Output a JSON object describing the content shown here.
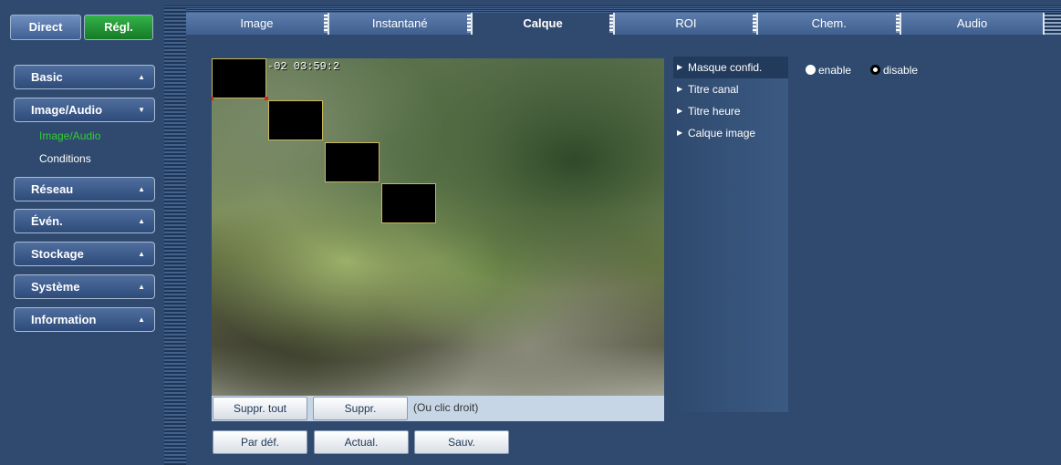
{
  "sidebar": {
    "mode_direct": "Direct",
    "mode_regl": "Régl.",
    "menu": [
      {
        "label": "Basic"
      },
      {
        "label": "Image/Audio"
      },
      {
        "label": "Réseau"
      },
      {
        "label": "Évén."
      },
      {
        "label": "Stockage"
      },
      {
        "label": "Système"
      },
      {
        "label": "Information"
      }
    ],
    "submenu": [
      {
        "label": "Image/Audio",
        "selected": true
      },
      {
        "label": "Conditions"
      }
    ]
  },
  "tabs": [
    {
      "label": "Image"
    },
    {
      "label": "Instantané"
    },
    {
      "label": "Calque",
      "active": true
    },
    {
      "label": "ROI"
    },
    {
      "label": "Chem."
    },
    {
      "label": "Audio"
    }
  ],
  "video": {
    "osd_time": "-02 03:59:2"
  },
  "video_bar": {
    "delete_all": "Suppr. tout",
    "delete": "Suppr.",
    "hint": "(Ou clic droit)"
  },
  "actions": {
    "default": "Par déf.",
    "refresh": "Actual.",
    "save": "Sauv."
  },
  "overlay_menu": [
    {
      "label": "Masque confid.",
      "active": true
    },
    {
      "label": "Titre canal"
    },
    {
      "label": "Titre heure"
    },
    {
      "label": "Calque image"
    }
  ],
  "privacy_mask": {
    "enable_label": "enable",
    "disable_label": "disable",
    "selected": "disable"
  },
  "colors": {
    "background": "#2f4a6e",
    "active_green": "#33cc33"
  }
}
